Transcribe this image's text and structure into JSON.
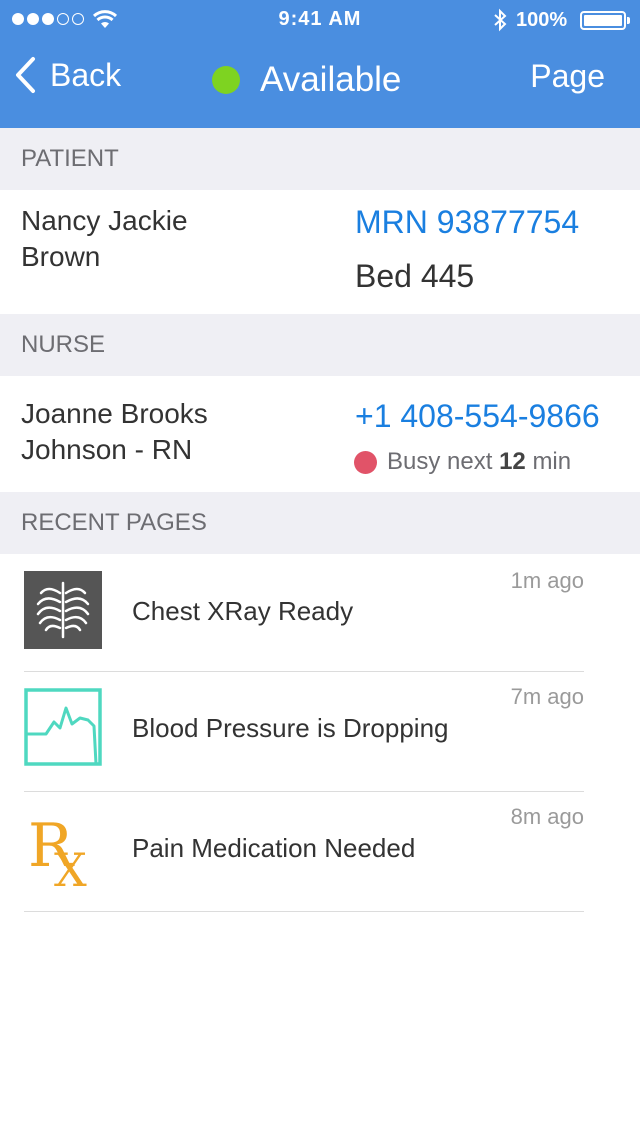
{
  "status_bar": {
    "time": "9:41 AM",
    "battery": "100%",
    "signal_icon": "signal-dots-icon",
    "wifi_icon": "wifi-icon",
    "bluetooth_icon": "bluetooth-icon"
  },
  "nav": {
    "back_label": "Back",
    "title": "Available",
    "action_label": "Page",
    "status_color": "#7ed321",
    "bar_color": "#4a8ee0"
  },
  "patient": {
    "header": "PATIENT",
    "name_line1": "Nancy Jackie",
    "name_line2": "Brown",
    "mrn": "MRN 93877754",
    "bed": "Bed 445"
  },
  "nurse": {
    "header": "NURSE",
    "name_line1": "Joanne Brooks",
    "name_line2": "Johnson - RN",
    "phone": "+1 408-554-9866",
    "busy_prefix": "Busy next",
    "busy_value": "12",
    "busy_unit": "min",
    "busy_color": "#e15368"
  },
  "recent": {
    "header": "RECENT PAGES",
    "items": [
      {
        "label": "Chest XRay Ready",
        "ago": "1m ago",
        "icon": "xray-chest-icon"
      },
      {
        "label": "Blood Pressure is Dropping",
        "ago": "7m ago",
        "icon": "vitals-chart-icon"
      },
      {
        "label": "Pain Medication Needed",
        "ago": "8m ago",
        "icon": "rx-prescription-icon"
      }
    ]
  }
}
